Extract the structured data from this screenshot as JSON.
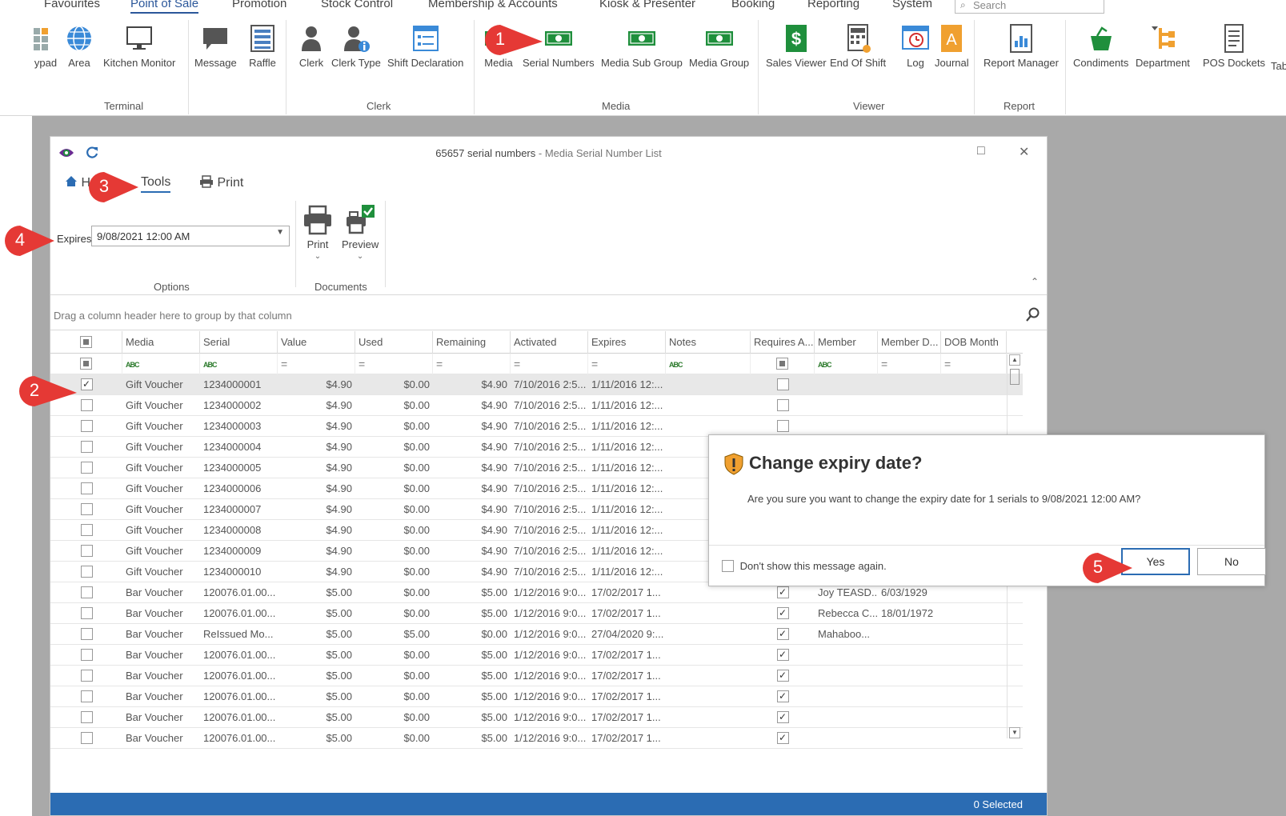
{
  "menu": {
    "tabs": [
      "Favourites",
      "Point of Sale",
      "Promotion",
      "Stock Control",
      "Membership & Accounts",
      "Kiosk & Presenter",
      "Booking",
      "Reporting",
      "System"
    ],
    "active_tab": "Point of Sale",
    "search_placeholder": "Search"
  },
  "ribbon": {
    "buttons": [
      "ypad",
      "Area",
      "Kitchen Monitor",
      "Message",
      "Raffle",
      "Clerk",
      "Clerk Type",
      "Shift Declaration",
      "Media",
      "Serial Numbers",
      "Media Sub Group",
      "Media Group",
      "Sales Viewer",
      "End Of Shift",
      "Log",
      "Journal",
      "Report Manager",
      "Condiments",
      "Department",
      "POS Dockets",
      "Tab"
    ],
    "groups": [
      "Terminal",
      "Clerk",
      "Media",
      "Viewer",
      "Report"
    ]
  },
  "window": {
    "title": "65657 serial numbers",
    "subtitle": " - Media Serial Number List",
    "tabs": {
      "home": "H",
      "tools": "Tools",
      "print": "Print"
    },
    "expires_label": "Expires",
    "expires_value": "9/08/2021 12:00 AM",
    "options_label": "Options",
    "documents_label": "Documents",
    "print_button": "Print",
    "preview_button": "Preview",
    "group_hint": "Drag a column header here to group by that column",
    "status": "0 Selected"
  },
  "grid": {
    "columns": [
      "Media",
      "Serial",
      "Value",
      "Used",
      "Remaining",
      "Activated",
      "Expires",
      "Notes",
      "Requires A...",
      "Member",
      "Member D...",
      "DOB Month"
    ],
    "rows": [
      {
        "checked": "✓",
        "media": "Gift Voucher",
        "serial": "1234000001",
        "value": "$4.90",
        "used": "$0.00",
        "remaining": "$4.90",
        "activated": "7/10/2016 2:5...",
        "expires": "1/11/2016 12:...",
        "requires": "",
        "member": "",
        "member_d": ""
      },
      {
        "checked": "",
        "media": "Gift Voucher",
        "serial": "1234000002",
        "value": "$4.90",
        "used": "$0.00",
        "remaining": "$4.90",
        "activated": "7/10/2016 2:5...",
        "expires": "1/11/2016 12:...",
        "requires": "",
        "member": "",
        "member_d": ""
      },
      {
        "checked": "",
        "media": "Gift Voucher",
        "serial": "1234000003",
        "value": "$4.90",
        "used": "$0.00",
        "remaining": "$4.90",
        "activated": "7/10/2016 2:5...",
        "expires": "1/11/2016 12:...",
        "requires": "",
        "member": "",
        "member_d": ""
      },
      {
        "checked": "",
        "media": "Gift Voucher",
        "serial": "1234000004",
        "value": "$4.90",
        "used": "$0.00",
        "remaining": "$4.90",
        "activated": "7/10/2016 2:5...",
        "expires": "1/11/2016 12:...",
        "requires": "",
        "member": "",
        "member_d": ""
      },
      {
        "checked": "",
        "media": "Gift Voucher",
        "serial": "1234000005",
        "value": "$4.90",
        "used": "$0.00",
        "remaining": "$4.90",
        "activated": "7/10/2016 2:5...",
        "expires": "1/11/2016 12:...",
        "requires": "",
        "member": "",
        "member_d": ""
      },
      {
        "checked": "",
        "media": "Gift Voucher",
        "serial": "1234000006",
        "value": "$4.90",
        "used": "$0.00",
        "remaining": "$4.90",
        "activated": "7/10/2016 2:5...",
        "expires": "1/11/2016 12:...",
        "requires": "",
        "member": "",
        "member_d": ""
      },
      {
        "checked": "",
        "media": "Gift Voucher",
        "serial": "1234000007",
        "value": "$4.90",
        "used": "$0.00",
        "remaining": "$4.90",
        "activated": "7/10/2016 2:5...",
        "expires": "1/11/2016 12:...",
        "requires": "",
        "member": "",
        "member_d": ""
      },
      {
        "checked": "",
        "media": "Gift Voucher",
        "serial": "1234000008",
        "value": "$4.90",
        "used": "$0.00",
        "remaining": "$4.90",
        "activated": "7/10/2016 2:5...",
        "expires": "1/11/2016 12:...",
        "requires": "",
        "member": "",
        "member_d": ""
      },
      {
        "checked": "",
        "media": "Gift Voucher",
        "serial": "1234000009",
        "value": "$4.90",
        "used": "$0.00",
        "remaining": "$4.90",
        "activated": "7/10/2016 2:5...",
        "expires": "1/11/2016 12:...",
        "requires": "",
        "member": "",
        "member_d": ""
      },
      {
        "checked": "",
        "media": "Gift Voucher",
        "serial": "1234000010",
        "value": "$4.90",
        "used": "$0.00",
        "remaining": "$4.90",
        "activated": "7/10/2016 2:5...",
        "expires": "1/11/2016 12:...",
        "requires": "",
        "member": "",
        "member_d": ""
      },
      {
        "checked": "",
        "media": "Bar Voucher",
        "serial": "120076.01.00...",
        "value": "$5.00",
        "used": "$0.00",
        "remaining": "$5.00",
        "activated": "1/12/2016 9:0...",
        "expires": "17/02/2017 1...",
        "requires": "✓",
        "member": "Joy TEASD...",
        "member_d": "6/03/1929"
      },
      {
        "checked": "",
        "media": "Bar Voucher",
        "serial": "120076.01.00...",
        "value": "$5.00",
        "used": "$0.00",
        "remaining": "$5.00",
        "activated": "1/12/2016 9:0...",
        "expires": "17/02/2017 1...",
        "requires": "✓",
        "member": "Rebecca C...",
        "member_d": "18/01/1972"
      },
      {
        "checked": "",
        "media": "Bar Voucher",
        "serial": "ReIssued Mo...",
        "value": "$5.00",
        "used": "$5.00",
        "remaining": "$0.00",
        "activated": "1/12/2016 9:0...",
        "expires": "27/04/2020 9:...",
        "requires": "✓",
        "member": "Mahaboo...",
        "member_d": ""
      },
      {
        "checked": "",
        "media": "Bar Voucher",
        "serial": "120076.01.00...",
        "value": "$5.00",
        "used": "$0.00",
        "remaining": "$5.00",
        "activated": "1/12/2016 9:0...",
        "expires": "17/02/2017 1...",
        "requires": "✓",
        "member": "",
        "member_d": ""
      },
      {
        "checked": "",
        "media": "Bar Voucher",
        "serial": "120076.01.00...",
        "value": "$5.00",
        "used": "$0.00",
        "remaining": "$5.00",
        "activated": "1/12/2016 9:0...",
        "expires": "17/02/2017 1...",
        "requires": "✓",
        "member": "",
        "member_d": ""
      },
      {
        "checked": "",
        "media": "Bar Voucher",
        "serial": "120076.01.00...",
        "value": "$5.00",
        "used": "$0.00",
        "remaining": "$5.00",
        "activated": "1/12/2016 9:0...",
        "expires": "17/02/2017 1...",
        "requires": "✓",
        "member": "",
        "member_d": ""
      },
      {
        "checked": "",
        "media": "Bar Voucher",
        "serial": "120076.01.00...",
        "value": "$5.00",
        "used": "$0.00",
        "remaining": "$5.00",
        "activated": "1/12/2016 9:0...",
        "expires": "17/02/2017 1...",
        "requires": "✓",
        "member": "",
        "member_d": ""
      },
      {
        "checked": "",
        "media": "Bar Voucher",
        "serial": "120076.01.00...",
        "value": "$5.00",
        "used": "$0.00",
        "remaining": "$5.00",
        "activated": "1/12/2016 9:0...",
        "expires": "17/02/2017 1...",
        "requires": "✓",
        "member": "",
        "member_d": ""
      }
    ]
  },
  "dialog": {
    "title": "Change expiry date?",
    "message": "Are you sure you want to change the expiry date for 1 serials to 9/08/2021 12:00 AM?",
    "dont_show": "Don't show this message again.",
    "yes": "Yes",
    "no": "No"
  },
  "callouts": [
    "1",
    "2",
    "3",
    "4",
    "5"
  ],
  "colors": {
    "accent": "#2b6cb3",
    "callout": "#e53935",
    "media_green": "#1f8f3c"
  }
}
